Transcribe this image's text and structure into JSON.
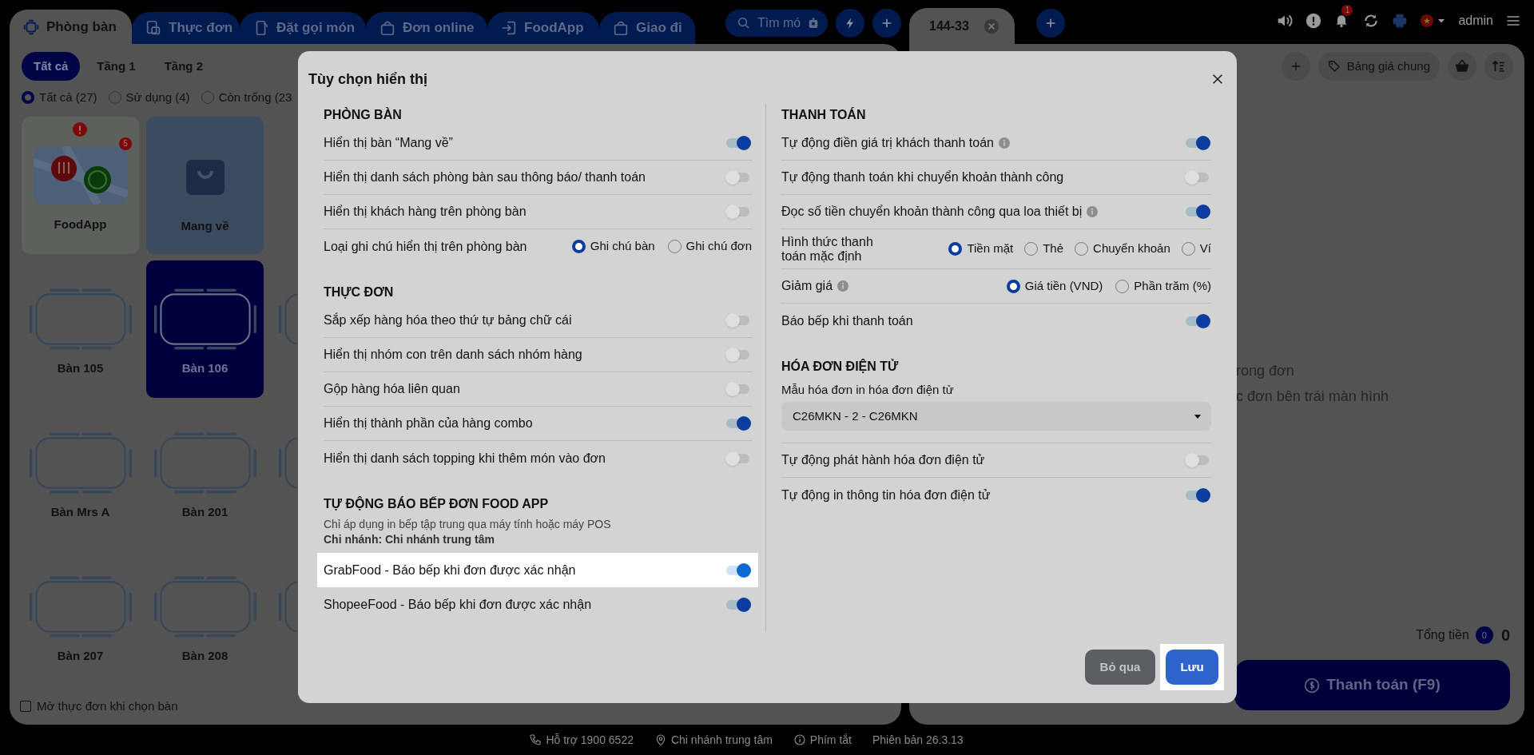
{
  "top_tabs": [
    {
      "label": "Phòng bàn",
      "selected": true
    },
    {
      "label": "Thực đơn",
      "selected": false
    },
    {
      "label": "Đặt gọi món",
      "selected": false
    },
    {
      "label": "Đơn online",
      "selected": false
    },
    {
      "label": "FoodApp",
      "selected": false
    },
    {
      "label": "Giao đi",
      "selected": false
    }
  ],
  "search": {
    "placeholder": "Tìm mó"
  },
  "order_tabs": [
    {
      "label": "144-33",
      "selected": true
    }
  ],
  "header": {
    "notification_count": "1",
    "user": "admin"
  },
  "floor_tabs": [
    {
      "label": "Tất cả",
      "selected": true
    },
    {
      "label": "Tầng 1",
      "selected": false
    },
    {
      "label": "Tầng 2",
      "selected": false
    }
  ],
  "status_filters": [
    {
      "label": "Tất cả (27)",
      "selected": true
    },
    {
      "label": "Sử dụng (4)",
      "selected": false
    },
    {
      "label": "Còn trống (23",
      "selected": false
    }
  ],
  "table_rows": [
    [
      {
        "kind": "foodapp",
        "label": "FoodApp",
        "count": "5"
      },
      {
        "kind": "takeaway",
        "label": "Mang về"
      }
    ],
    [
      {
        "kind": "table",
        "label": "Bàn 105",
        "selected": false
      },
      {
        "kind": "table",
        "label": "Bàn 106",
        "selected": true
      },
      {
        "kind": "table",
        "selected": false
      }
    ],
    [
      {
        "kind": "table",
        "label": "Bàn Mrs A",
        "selected": false
      },
      {
        "kind": "table",
        "label": "Bàn 201",
        "selected": false
      },
      {
        "kind": "table",
        "selected": false
      }
    ],
    [
      {
        "kind": "table",
        "label": "Bàn 207",
        "selected": false
      },
      {
        "kind": "table",
        "label": "Bàn 208",
        "selected": false
      },
      {
        "kind": "table",
        "selected": false
      }
    ]
  ],
  "open_menu_on_select": {
    "label": "Mở thực đơn khi chọn bàn",
    "checked": false
  },
  "order_panel": {
    "price_list": "Bảng giá chung",
    "empty_lines": [
      "rong đơn",
      "c đơn bên trái màn hình"
    ],
    "total_label": "Tổng tiền",
    "item_count": "0",
    "total": "0",
    "pay_button": "Thanh toán (F9)"
  },
  "footer": [
    {
      "kind": "phone",
      "text": "Hỗ trợ 1900 6522"
    },
    {
      "kind": "location",
      "text": "Chi nhánh trung tâm"
    },
    {
      "kind": "info",
      "text": "Phím tắt"
    },
    {
      "kind": "version",
      "text": "Phiên bản 26.3.13"
    }
  ],
  "dialog": {
    "title": "Tùy chọn hiển thị",
    "columns": [
      {
        "sections": [
          {
            "heading": "PHÒNG BÀN",
            "rows": [
              {
                "kind": "toggle",
                "label": "Hiển thị bàn “Mang về”",
                "on": true
              },
              {
                "kind": "toggle",
                "label": "Hiển thị danh sách phòng bàn sau thông báo/ thanh toán",
                "on": false
              },
              {
                "kind": "toggle",
                "label": "Hiển thị khách hàng trên phòng bàn",
                "on": false
              },
              {
                "kind": "radio",
                "label": "Loại ghi chú hiển thị trên phòng bàn",
                "options": [
                  {
                    "label": "Ghi chú bàn",
                    "selected": true
                  },
                  {
                    "label": "Ghi chú đơn",
                    "selected": false
                  }
                ]
              }
            ]
          },
          {
            "heading": "THỰC ĐƠN",
            "rows": [
              {
                "kind": "toggle",
                "label": "Sắp xếp hàng hóa theo thứ tự bảng chữ cái",
                "on": false
              },
              {
                "kind": "toggle",
                "label": "Hiển thị nhóm con trên danh sách nhóm hàng",
                "on": false
              },
              {
                "kind": "toggle",
                "label": "Gộp hàng hóa liên quan",
                "on": false
              },
              {
                "kind": "toggle",
                "label": "Hiển thị thành phần của hàng combo",
                "on": true
              },
              {
                "kind": "toggle",
                "label": "Hiển thị danh sách topping khi thêm món vào đơn",
                "on": false
              }
            ]
          },
          {
            "heading": "TỰ ĐỘNG BÁO BẾP ĐƠN FOOD APP",
            "note": "Chỉ áp dụng in bếp tập trung qua máy tính hoặc máy POS",
            "branch": "Chi nhánh: Chi nhánh trung tâm",
            "rows": [
              {
                "kind": "toggle",
                "label": "GrabFood - Báo bếp khi đơn được xác nhận",
                "on": true,
                "highlighted": true
              },
              {
                "kind": "toggle",
                "label": "ShopeeFood - Báo bếp khi đơn được xác nhận",
                "on": true
              }
            ]
          }
        ]
      },
      {
        "sections": [
          {
            "heading": "THANH TOÁN",
            "rows": [
              {
                "kind": "toggle",
                "label": "Tự động điền giá trị khách thanh toán",
                "info": true,
                "on": true
              },
              {
                "kind": "toggle",
                "label": "Tự động thanh toán khi chuyển khoản thành công",
                "on": false
              },
              {
                "kind": "toggle",
                "label": "Đọc số tiền chuyển khoản thành công qua loa thiết bị",
                "info": true,
                "on": true
              },
              {
                "kind": "radio",
                "label": "Hình thức thanh toán mặc định",
                "options": [
                  {
                    "label": "Tiền mặt",
                    "selected": true
                  },
                  {
                    "label": "Thẻ",
                    "selected": false
                  },
                  {
                    "label": "Chuyển khoản",
                    "selected": false
                  },
                  {
                    "label": "Ví",
                    "selected": false
                  }
                ]
              },
              {
                "kind": "radio",
                "label": "Giảm giá",
                "info": true,
                "options": [
                  {
                    "label": "Giá tiền (VND)",
                    "selected": true
                  },
                  {
                    "label": "Phần trăm (%)",
                    "selected": false
                  }
                ]
              },
              {
                "kind": "toggle",
                "label": "Báo bếp khi thanh toán",
                "on": true
              }
            ]
          },
          {
            "heading": "HÓA ĐƠN ĐIỆN TỬ",
            "rows": [
              {
                "kind": "select",
                "label": "Mẫu hóa đơn in hóa đơn điện tử",
                "value": "C26MKN - 2 - C26MKN"
              },
              {
                "kind": "toggle",
                "label": "Tự động phát hành hóa đơn điện tử",
                "on": false
              },
              {
                "kind": "toggle",
                "label": "Tự động in thông tin hóa đơn điện tử",
                "on": true
              }
            ]
          }
        ]
      }
    ],
    "buttons": [
      {
        "label": "Bỏ qua",
        "kind": "secondary"
      },
      {
        "label": "Lưu",
        "kind": "primary",
        "highlighted": true
      }
    ]
  }
}
